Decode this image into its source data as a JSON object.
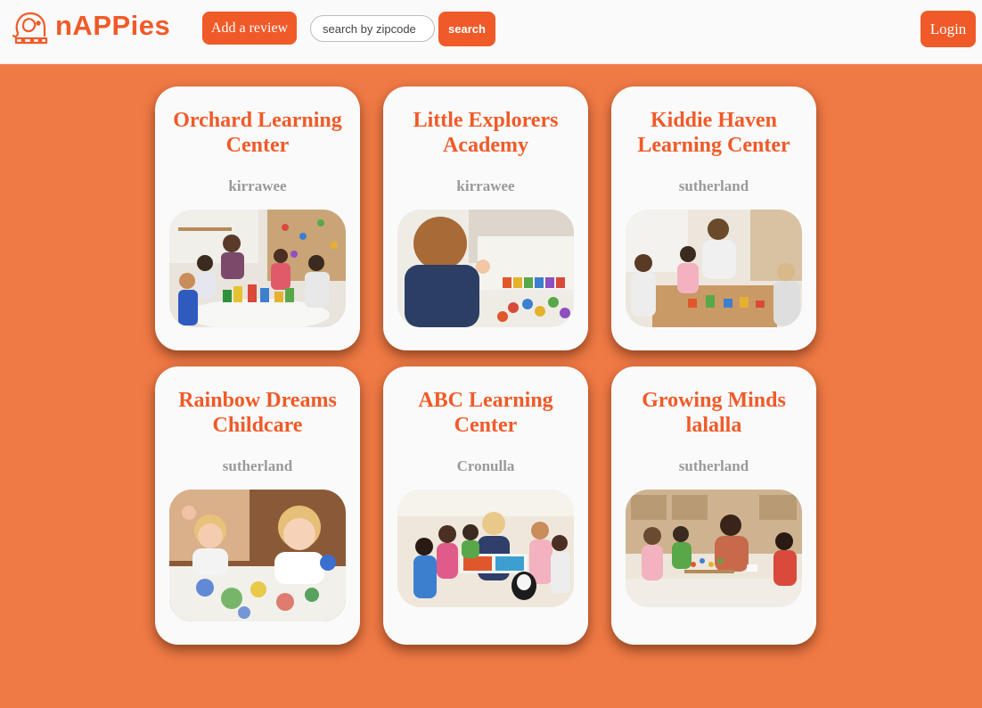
{
  "header": {
    "brand": "nAPPies",
    "add_review_label": "Add a review",
    "search_placeholder": "search by zipcode",
    "search_value": "",
    "search_label": "search",
    "login_label": "Login"
  },
  "colors": {
    "accent": "#f05a28",
    "page_background": "#f07a45",
    "card_background": "#fafafa",
    "location_text": "#9a9a9a"
  },
  "centers": [
    {
      "name": "Orchard Learning Center",
      "location": "kirrawee",
      "image": "children-building-blocks-photo"
    },
    {
      "name": "Little Explorers Academy",
      "location": "kirrawee",
      "image": "child-playing-abacus-photo"
    },
    {
      "name": "Kiddie Haven Learning Center",
      "location": "sutherland",
      "image": "teacher-with-children-photo"
    },
    {
      "name": "Rainbow Dreams Childcare",
      "location": "sutherland",
      "image": "toddlers-finger-painting-photo"
    },
    {
      "name": "ABC Learning Center",
      "location": "Cronulla",
      "image": "teacher-reading-book-photo"
    },
    {
      "name": "Growing Minds lalalla",
      "location": "sutherland",
      "image": "children-playing-abacus-photo"
    }
  ]
}
